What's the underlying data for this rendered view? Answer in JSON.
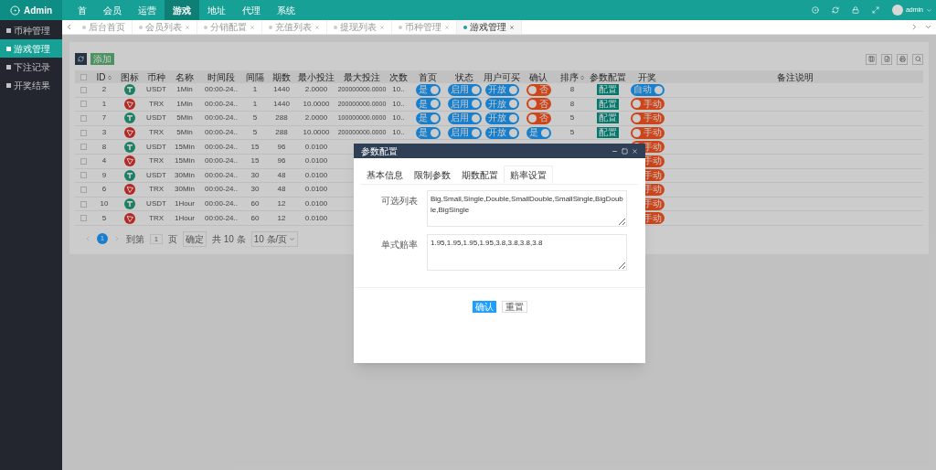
{
  "brand": {
    "title": "Admin"
  },
  "top_nav": [
    {
      "label": "首",
      "selected": false
    },
    {
      "label": "会员",
      "selected": false
    },
    {
      "label": "运营",
      "selected": false
    },
    {
      "label": "游戏",
      "selected": true
    },
    {
      "label": "地址",
      "selected": false
    },
    {
      "label": "代理",
      "selected": false
    },
    {
      "label": "系统",
      "selected": false
    }
  ],
  "user": {
    "name": "admin"
  },
  "sidebar": {
    "items": [
      {
        "label": "币种管理",
        "selected": false
      },
      {
        "label": "游戏管理",
        "selected": true
      },
      {
        "label": "下注记录",
        "selected": false
      },
      {
        "label": "开奖结果",
        "selected": false
      }
    ]
  },
  "page_tabs": [
    {
      "label": "后台首页",
      "selected": false,
      "closable": false
    },
    {
      "label": "会员列表",
      "selected": false,
      "closable": true
    },
    {
      "label": "分销配置",
      "selected": false,
      "closable": true
    },
    {
      "label": "充值列表",
      "selected": false,
      "closable": true
    },
    {
      "label": "提现列表",
      "selected": false,
      "closable": true
    },
    {
      "label": "币种管理",
      "selected": false,
      "closable": true
    },
    {
      "label": "游戏管理",
      "selected": true,
      "closable": true
    }
  ],
  "toolbar": {
    "add_button": "添加"
  },
  "table": {
    "select_all_checked": false,
    "columns": [
      {
        "label": "ID",
        "sortable": true
      },
      {
        "label": "图标",
        "sortable": false
      },
      {
        "label": "币种",
        "sortable": false
      },
      {
        "label": "名称",
        "sortable": false
      },
      {
        "label": "时间段",
        "sortable": false
      },
      {
        "label": "间隔",
        "sortable": false
      },
      {
        "label": "期数",
        "sortable": false
      },
      {
        "label": "最小投注",
        "sortable": false
      },
      {
        "label": "最大投注",
        "sortable": false
      },
      {
        "label": "次数",
        "sortable": false
      },
      {
        "label": "首页",
        "sortable": false
      },
      {
        "label": "状态",
        "sortable": false
      },
      {
        "label": "用户可买",
        "sortable": false
      },
      {
        "label": "确认",
        "sortable": false
      },
      {
        "label": "排序",
        "sortable": true
      },
      {
        "label": "参数配置",
        "sortable": false
      },
      {
        "label": "开奖",
        "sortable": false
      },
      {
        "label": "备注说明",
        "sortable": false
      }
    ],
    "rows": [
      {
        "checked": false,
        "id": "2",
        "kind": "tee",
        "coin": "USDT",
        "name": "1Min",
        "period": "00:00-24..",
        "interval": "1",
        "issues": "1440",
        "min_bet": "2.0000",
        "max_bet": "200000000.0000",
        "times": "10..",
        "home": {
          "label": "是",
          "on": true
        },
        "status": {
          "label": "启用",
          "on": true
        },
        "buyable": {
          "label": "开放",
          "on": true
        },
        "confirm": {
          "label": "否",
          "on": false
        },
        "sort": "8",
        "config": "配置",
        "draw": {
          "label": "自动",
          "on": true
        }
      },
      {
        "checked": false,
        "id": "1",
        "kind": "triangle",
        "coin": "TRX",
        "name": "1Min",
        "period": "00:00-24..",
        "interval": "1",
        "issues": "1440",
        "min_bet": "10.0000",
        "max_bet": "200000000.0000",
        "times": "10..",
        "home": {
          "label": "是",
          "on": true
        },
        "status": {
          "label": "启用",
          "on": true
        },
        "buyable": {
          "label": "开放",
          "on": true
        },
        "confirm": {
          "label": "否",
          "on": false
        },
        "sort": "8",
        "config": "配置",
        "draw": {
          "label": "手动",
          "on": false
        }
      },
      {
        "checked": false,
        "id": "7",
        "kind": "tee",
        "coin": "USDT",
        "name": "5Min",
        "period": "00:00-24..",
        "interval": "5",
        "issues": "288",
        "min_bet": "2.0000",
        "max_bet": "100000000.0000",
        "times": "10..",
        "home": {
          "label": "是",
          "on": true
        },
        "status": {
          "label": "启用",
          "on": true
        },
        "buyable": {
          "label": "开放",
          "on": true
        },
        "confirm": {
          "label": "否",
          "on": false
        },
        "sort": "5",
        "config": "配置",
        "draw": {
          "label": "手动",
          "on": false
        }
      },
      {
        "checked": false,
        "id": "3",
        "kind": "triangle",
        "coin": "TRX",
        "name": "5Min",
        "period": "00:00-24..",
        "interval": "5",
        "issues": "288",
        "min_bet": "10.0000",
        "max_bet": "200000000.0000",
        "times": "10..",
        "home": {
          "label": "是",
          "on": true
        },
        "status": {
          "label": "启用",
          "on": true
        },
        "buyable": {
          "label": "开放",
          "on": true
        },
        "confirm": {
          "label": "是",
          "on": true
        },
        "sort": "5",
        "config": "配置",
        "draw": {
          "label": "手动",
          "on": false
        }
      },
      {
        "checked": false,
        "id": "8",
        "kind": "tee",
        "coin": "USDT",
        "name": "15Min",
        "period": "00:00-24..",
        "interval": "15",
        "issues": "96",
        "min_bet": "0.0100",
        "draw": {
          "label": "手动",
          "on": false
        }
      },
      {
        "checked": false,
        "id": "4",
        "kind": "triangle",
        "coin": "TRX",
        "name": "15Min",
        "period": "00:00-24..",
        "interval": "15",
        "issues": "96",
        "min_bet": "0.0100",
        "draw": {
          "label": "手动",
          "on": false
        }
      },
      {
        "checked": false,
        "id": "9",
        "kind": "tee",
        "coin": "USDT",
        "name": "30Min",
        "period": "00:00-24..",
        "interval": "30",
        "issues": "48",
        "min_bet": "0.0100",
        "draw": {
          "label": "手动",
          "on": false
        }
      },
      {
        "checked": false,
        "id": "6",
        "kind": "triangle",
        "coin": "TRX",
        "name": "30Min",
        "period": "00:00-24..",
        "interval": "30",
        "issues": "48",
        "min_bet": "0.0100",
        "draw": {
          "label": "手动",
          "on": false
        }
      },
      {
        "checked": false,
        "id": "10",
        "kind": "tee",
        "coin": "USDT",
        "name": "1Hour",
        "period": "00:00-24..",
        "interval": "60",
        "issues": "12",
        "min_bet": "0.0100",
        "draw": {
          "label": "手动",
          "on": false
        }
      },
      {
        "checked": false,
        "id": "5",
        "kind": "triangle",
        "coin": "TRX",
        "name": "1Hour",
        "period": "00:00-24..",
        "interval": "60",
        "issues": "12",
        "min_bet": "0.0100",
        "draw": {
          "label": "手动",
          "on": false
        }
      }
    ]
  },
  "pagination": {
    "pages": [
      {
        "label": "1",
        "selected": true
      }
    ],
    "goto_label": "到第",
    "goto_value": "1",
    "page_unit": "页",
    "confirm": "确定",
    "total": "共 10 条",
    "page_size": "10 条/页"
  },
  "dialog": {
    "title": "参数配置",
    "tabs": [
      {
        "label": "基本信息",
        "selected": false
      },
      {
        "label": "限制参数",
        "selected": false
      },
      {
        "label": "期数配置",
        "selected": false
      },
      {
        "label": "赔率设置",
        "selected": true
      }
    ],
    "fields": [
      {
        "label": "可选列表",
        "value": "Big,Small,Single,Double,SmallDouble,SmallSingle,BigDouble,BigSingle"
      },
      {
        "label": "单式赔率",
        "value": "1.95,1.95,1.95,1.95,3.8,3.8,3.8,3.8"
      }
    ],
    "buttons": [
      {
        "label": "确认",
        "kind": "primary"
      },
      {
        "label": "重置",
        "kind": "plain"
      }
    ]
  }
}
